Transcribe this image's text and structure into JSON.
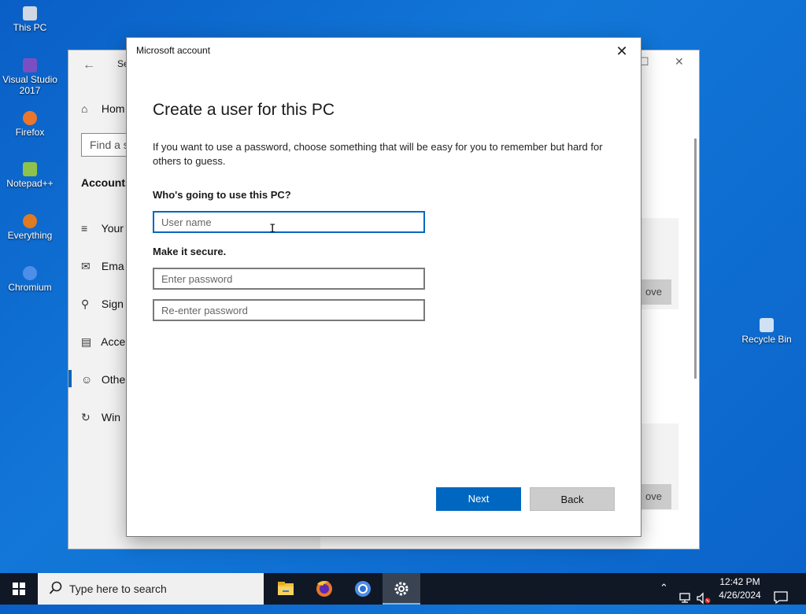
{
  "desktop": {
    "icons": [
      {
        "label": "This PC",
        "icon": "computer-icon",
        "color": "#cfd8e3"
      },
      {
        "label": "Visual Studio 2017",
        "icon": "visual-studio-icon",
        "color": "#7b4fc2"
      },
      {
        "label": "Firefox",
        "icon": "firefox-icon",
        "color": "#e8762d"
      },
      {
        "label": "Notepad++",
        "icon": "notepad-plus-plus-icon",
        "color": "#8fc24a"
      },
      {
        "label": "Everything",
        "icon": "everything-search-icon",
        "color": "#e07b22"
      },
      {
        "label": "Chromium",
        "icon": "chromium-icon",
        "color": "#4d8ee8"
      },
      {
        "label": "Recycle Bin",
        "icon": "recycle-bin-icon",
        "color": "#cfe1f5"
      }
    ]
  },
  "settings_window": {
    "title": "Se",
    "find_placeholder": "Find a s",
    "home_label": "Hom",
    "section": "Accounts",
    "nav": [
      {
        "label": "Your",
        "icon": "user-info-icon"
      },
      {
        "label": "Ema",
        "icon": "mail-icon"
      },
      {
        "label": "Sign",
        "icon": "key-icon"
      },
      {
        "label": "Acce",
        "icon": "briefcase-icon"
      },
      {
        "label": "Othe",
        "icon": "add-person-icon"
      },
      {
        "label": "Win",
        "icon": "sync-icon"
      }
    ],
    "remove_label_1": "ove",
    "remove_label_2": "ove"
  },
  "dialog": {
    "title": "Microsoft account",
    "heading": "Create a user for this PC",
    "description": "If you want to use a password, choose something that will be easy for you to remember but hard for others to guess.",
    "who_label": "Who's going to use this PC?",
    "username_placeholder": "User name",
    "secure_label": "Make it secure.",
    "password_placeholder": "Enter password",
    "reenter_placeholder": "Re-enter password",
    "next_label": "Next",
    "back_label": "Back",
    "accent": "#0067c0"
  },
  "taskbar": {
    "search_placeholder": "Type here to search",
    "apps": [
      "file-explorer-icon",
      "firefox-icon",
      "chromium-icon",
      "settings-gear-icon"
    ],
    "time": "12:42 PM",
    "date": "4/26/2024"
  }
}
